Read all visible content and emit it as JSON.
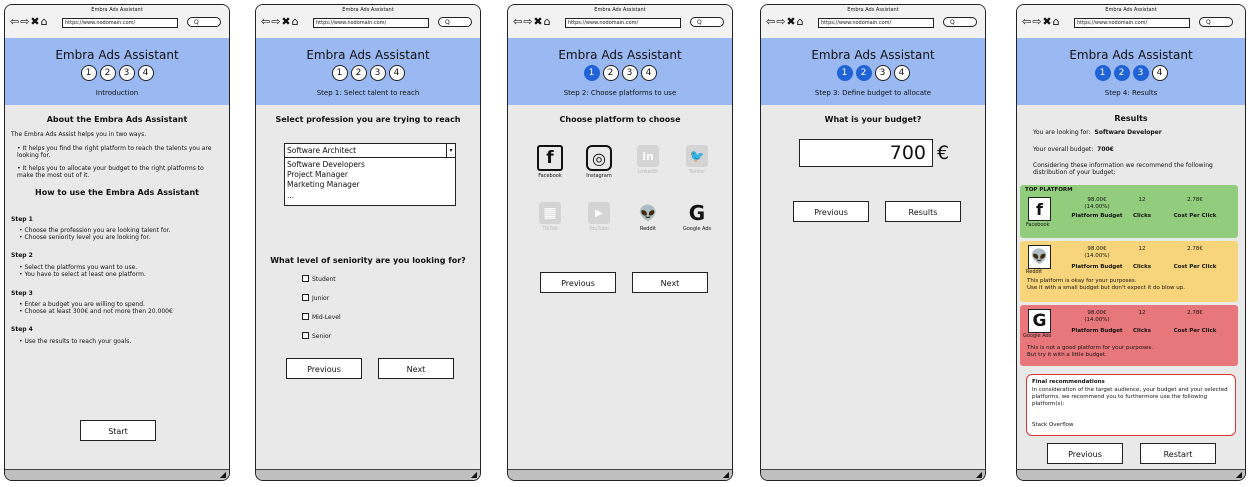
{
  "browser": {
    "window_title": "Embra Ads Assistant",
    "nav_glyphs": "⇦⇨✖⌂",
    "url": "https://www.nodomain.com/",
    "search_glyph": "Q"
  },
  "app": {
    "title": "Embra Ads Assistant",
    "steps": [
      "1",
      "2",
      "3",
      "4"
    ]
  },
  "screen1": {
    "subtitle": "Introduction",
    "about_heading": "About the Embra Ads Assistant",
    "about_intro": "The Embra Ads Assist helps you in two ways.",
    "about_points": [
      "It helps you find the right platform to reach the talents you are looking for.",
      "It helps you to allocate your budget to the right platforms to make the most out of it."
    ],
    "howto_heading": "How to use the Embra Ads Assistant",
    "steps": [
      {
        "title": "Step 1",
        "lines": [
          "Choose the profession you are looking talent for.",
          "Choose seniority level you are looking for."
        ]
      },
      {
        "title": "Step 2",
        "lines": [
          "Select the platforms you want to use.",
          "You have to select at least one platform."
        ]
      },
      {
        "title": "Step 3",
        "lines": [
          "Enter a budget you are willing to spend.",
          "Choose at least 300€ and not more then 20.000€"
        ]
      },
      {
        "title": "Step 4",
        "lines": [
          "Use the results to reach your goals."
        ]
      }
    ],
    "start_button": "Start"
  },
  "screen2": {
    "subtitle": "Step 1: Select talent to reach",
    "profession_heading": "Select profession you are trying to reach",
    "select_value": "Software Architect",
    "select_arrow": "▾",
    "options": [
      "Software Developers",
      "Project Manager",
      "Marketing Manager",
      "..."
    ],
    "seniority_heading": "What level of seniority are you looking for?",
    "seniority_options": [
      "Student",
      "Junior",
      "Mid-Level",
      "Senior"
    ],
    "prev_button": "Previous",
    "next_button": "Next"
  },
  "screen3": {
    "subtitle": "Step 2: Choose platforms to use",
    "heading": "Choose platform to choose",
    "platforms": [
      {
        "name": "Facebook",
        "icon": "facebook-icon",
        "glyph": "f",
        "active": true
      },
      {
        "name": "Instagram",
        "icon": "instagram-icon",
        "glyph": "◎",
        "active": true
      },
      {
        "name": "LinkedIn",
        "icon": "linkedin-icon",
        "glyph": "in",
        "active": false
      },
      {
        "name": "Twitter",
        "icon": "twitter-icon",
        "glyph": "🐦",
        "active": false
      },
      {
        "name": "TikTok",
        "icon": "tiktok-icon",
        "glyph": "▦",
        "active": false
      },
      {
        "name": "YouTube",
        "icon": "youtube-icon",
        "glyph": "▶",
        "active": false
      },
      {
        "name": "Reddit",
        "icon": "reddit-icon",
        "glyph": "👽",
        "active": true
      },
      {
        "name": "Google Ads",
        "icon": "google-ads-icon",
        "glyph": "G",
        "active": true
      }
    ],
    "prev_button": "Previous",
    "next_button": "Next"
  },
  "screen4": {
    "subtitle": "Step 3: Define budget to allocate",
    "heading": "What is your budget?",
    "budget_value": "700",
    "currency": "€",
    "prev_button": "Previous",
    "results_button": "Results"
  },
  "screen5": {
    "subtitle": "Step 4: Results",
    "heading": "Results",
    "looking_for_label": "You are looking for:",
    "looking_for_value": "Software Developer",
    "budget_label": "Your overall budget:",
    "budget_value": "700€",
    "recommend_text": "Considering these information we recommend the following distribution of your budget:",
    "cards": [
      {
        "tag": "TOP PLATFORM",
        "platform": "Facebook",
        "glyph": "f",
        "icon": "facebook-icon",
        "budget": "98.00€",
        "percent": "(14.00%)",
        "clicks": "12",
        "cpc": "2.78€",
        "budget_label": "Platform Budget",
        "clicks_label": "Clicks",
        "cpc_label": "Cost Per Click",
        "note1": "",
        "note2": "",
        "color": "#92cd7e"
      },
      {
        "tag": "",
        "platform": "Reddit",
        "glyph": "👽",
        "icon": "reddit-icon",
        "budget": "98.00€",
        "percent": "(14.00%)",
        "clicks": "12",
        "cpc": "2.78€",
        "budget_label": "Platform Budget",
        "clicks_label": "Clicks",
        "cpc_label": "Cost Per Click",
        "note1": "This platform is okay for your purposes.",
        "note2": "Use it with a small budget but don't expect it do blow up.",
        "color": "#f8d47a"
      },
      {
        "tag": "",
        "platform": "Google Ads",
        "glyph": "G",
        "icon": "google-ads-icon",
        "budget": "98.00€",
        "percent": "(14.00%)",
        "clicks": "12",
        "cpc": "2.78€",
        "budget_label": "Platform Budget",
        "clicks_label": "Clicks",
        "cpc_label": "Cost Per Click",
        "note1": "This is not a good platform for your purposes.",
        "note2": "But try it with a little budget.",
        "color": "#e8777b"
      }
    ],
    "final_heading": "Final recommendations",
    "final_text": "In consideration of the target audience, your budget and your selected platforms, we recommend you to furthermore use the following platform(s):",
    "final_platform": "Stack Overflow",
    "prev_button": "Previous",
    "restart_button": "Restart"
  },
  "resize_glyph": "◢"
}
